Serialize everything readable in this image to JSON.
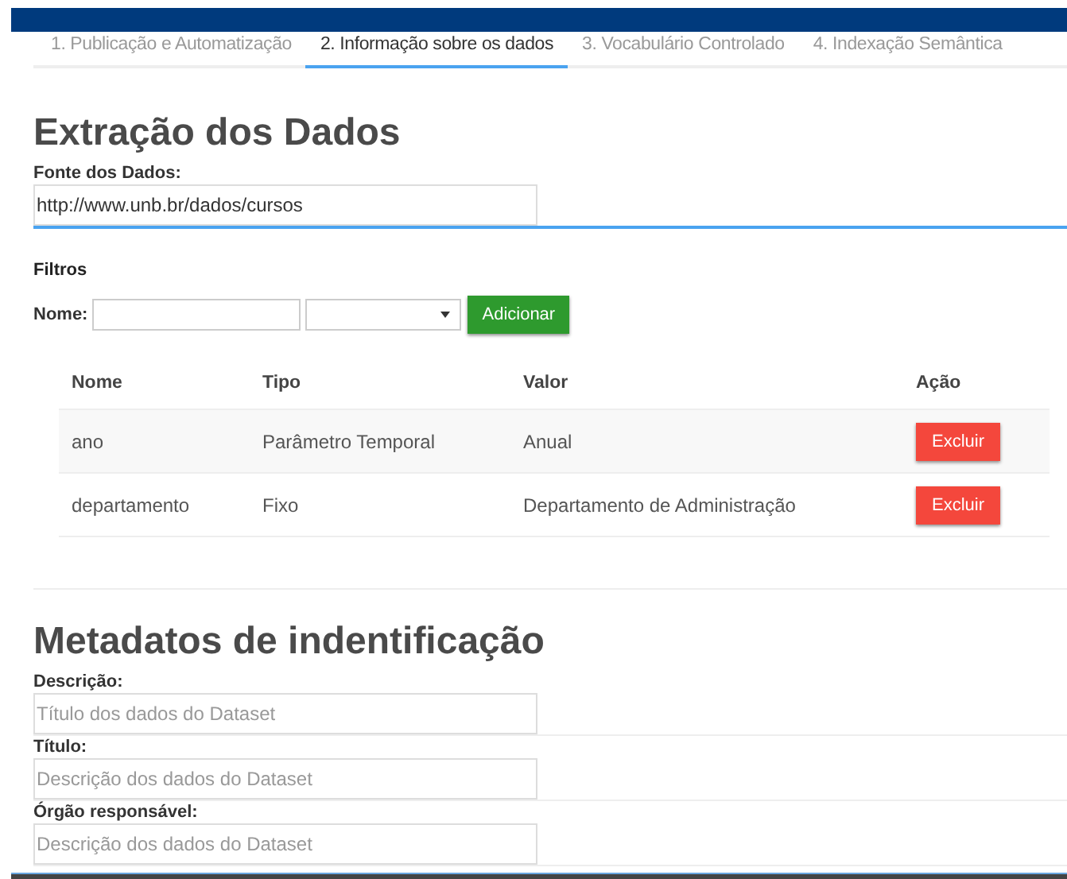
{
  "tabs": [
    {
      "label": "1. Publicação e Automatização",
      "selected": false
    },
    {
      "label": "2. Informação sobre os dados",
      "selected": true
    },
    {
      "label": "3. Vocabulário Controlado",
      "selected": false
    },
    {
      "label": "4. Indexação Semântica",
      "selected": false
    }
  ],
  "extraction": {
    "title": "Extração dos Dados",
    "source_label": "Fonte dos Dados:",
    "source_value": "http://www.unb.br/dados/cursos",
    "filters": {
      "title": "Filtros",
      "name_label": "Nome:",
      "add_button": "Adicionar"
    },
    "table": {
      "columns": [
        "Nome",
        "Tipo",
        "Valor",
        "Ação"
      ],
      "rows": [
        {
          "nome": "ano",
          "tipo": "Parâmetro Temporal",
          "valor": "Anual",
          "action": "Excluir"
        },
        {
          "nome": "departamento",
          "tipo": "Fixo",
          "valor": "Departamento de Administração",
          "action": "Excluir"
        }
      ]
    }
  },
  "metadata": {
    "title": "Metadatos de indentificação",
    "fields": [
      {
        "label": "Descrição:",
        "placeholder": "Título dos dados do Dataset"
      },
      {
        "label": "Título:",
        "placeholder": "Descrição dos dados do Dataset"
      },
      {
        "label": "Órgão responsável:",
        "placeholder": "Descrição dos dados do Dataset"
      }
    ]
  }
}
